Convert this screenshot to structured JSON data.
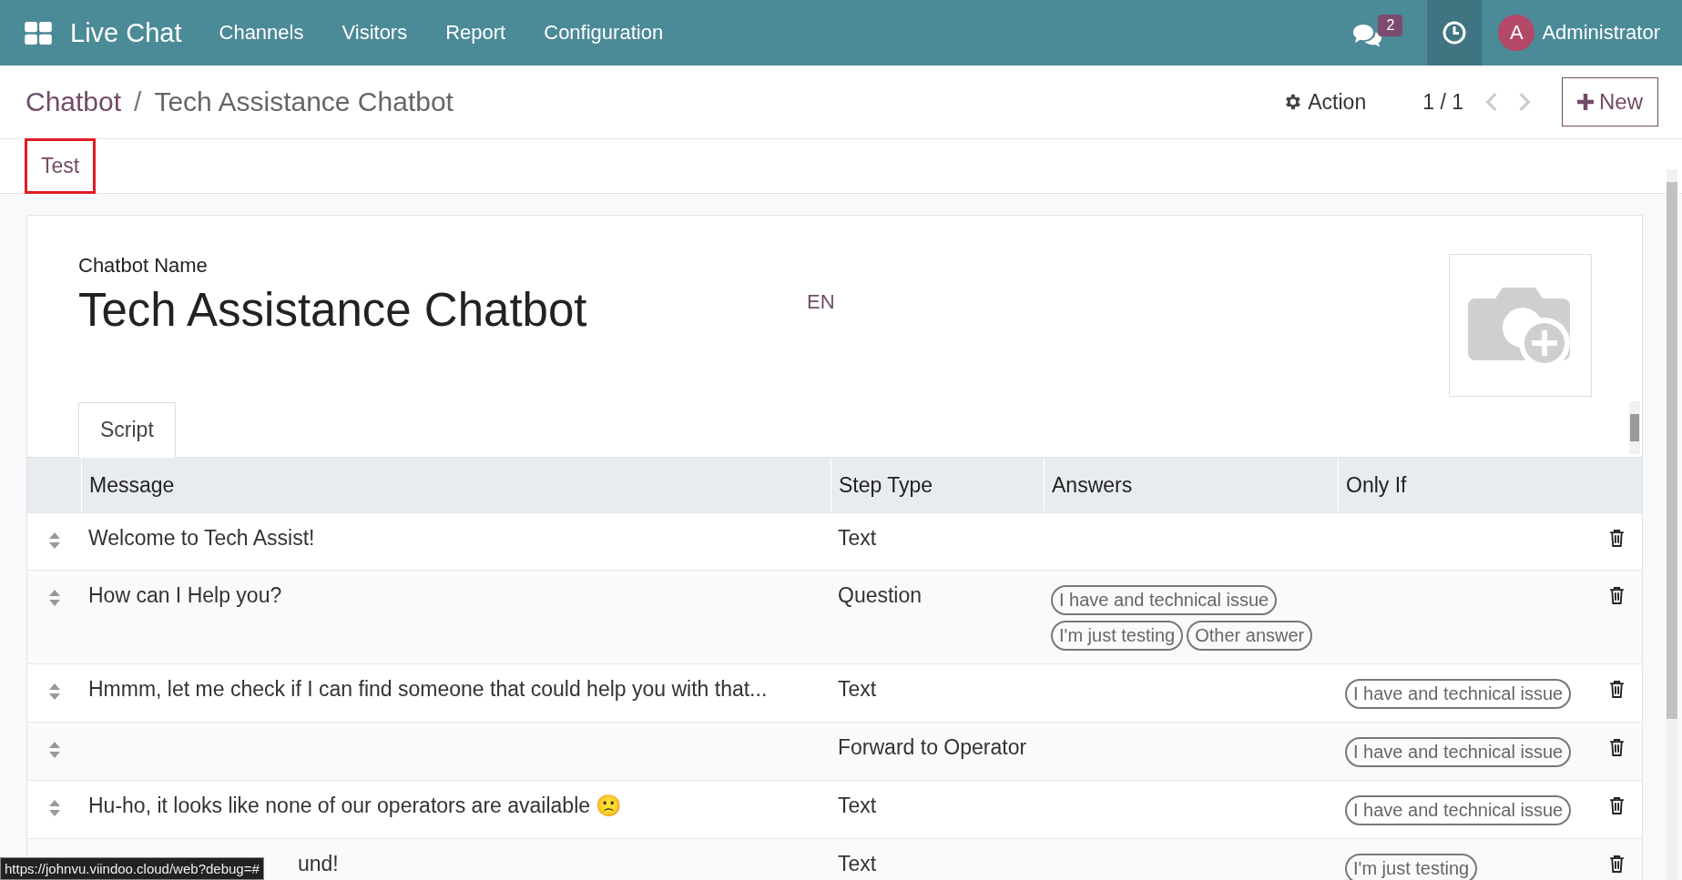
{
  "navbar": {
    "app_name": "Live Chat",
    "menu": [
      "Channels",
      "Visitors",
      "Report",
      "Configuration"
    ],
    "messages_count": "2",
    "user_initial": "A",
    "user_name": "Administrator"
  },
  "breadcrumb": {
    "parent": "Chatbot",
    "separator": "/",
    "current": "Tech Assistance Chatbot"
  },
  "control_panel": {
    "action": "Action",
    "pager": "1 / 1",
    "new_button": "New"
  },
  "status_buttons": [
    {
      "label": "Test",
      "highlighted": true
    }
  ],
  "form": {
    "name_label": "Chatbot Name",
    "name": "Tech Assistance Chatbot",
    "language": "EN"
  },
  "tabs": [
    {
      "label": "Script",
      "selected": true
    }
  ],
  "table": {
    "columns": [
      "Message",
      "Step Type",
      "Answers",
      "Only If"
    ],
    "rows": [
      {
        "message": "Welcome to Tech Assist!",
        "step_type": "Text",
        "answers": [],
        "only_if": []
      },
      {
        "message": "How can I Help you?",
        "step_type": "Question",
        "answers": [
          "I have and technical issue",
          "I'm just testing",
          "Other answer"
        ],
        "only_if": []
      },
      {
        "message": "Hmmm, let me check if I can find someone that could help you with that...",
        "step_type": "Text",
        "answers": [],
        "only_if": [
          "I have and technical issue"
        ]
      },
      {
        "message": "",
        "step_type": "Forward to Operator",
        "answers": [],
        "only_if": [
          "I have and technical issue"
        ]
      },
      {
        "message": "Hu-ho, it looks like none of our operators are available 🙁",
        "step_type": "Text",
        "answers": [],
        "only_if": [
          "I have and technical issue"
        ]
      },
      {
        "message": "und!",
        "step_type": "Text",
        "answers": [],
        "only_if": [
          "I'm just testing"
        ]
      }
    ]
  },
  "status_tooltip": "https://johnvu.viindoo.cloud/web?debug=#"
}
